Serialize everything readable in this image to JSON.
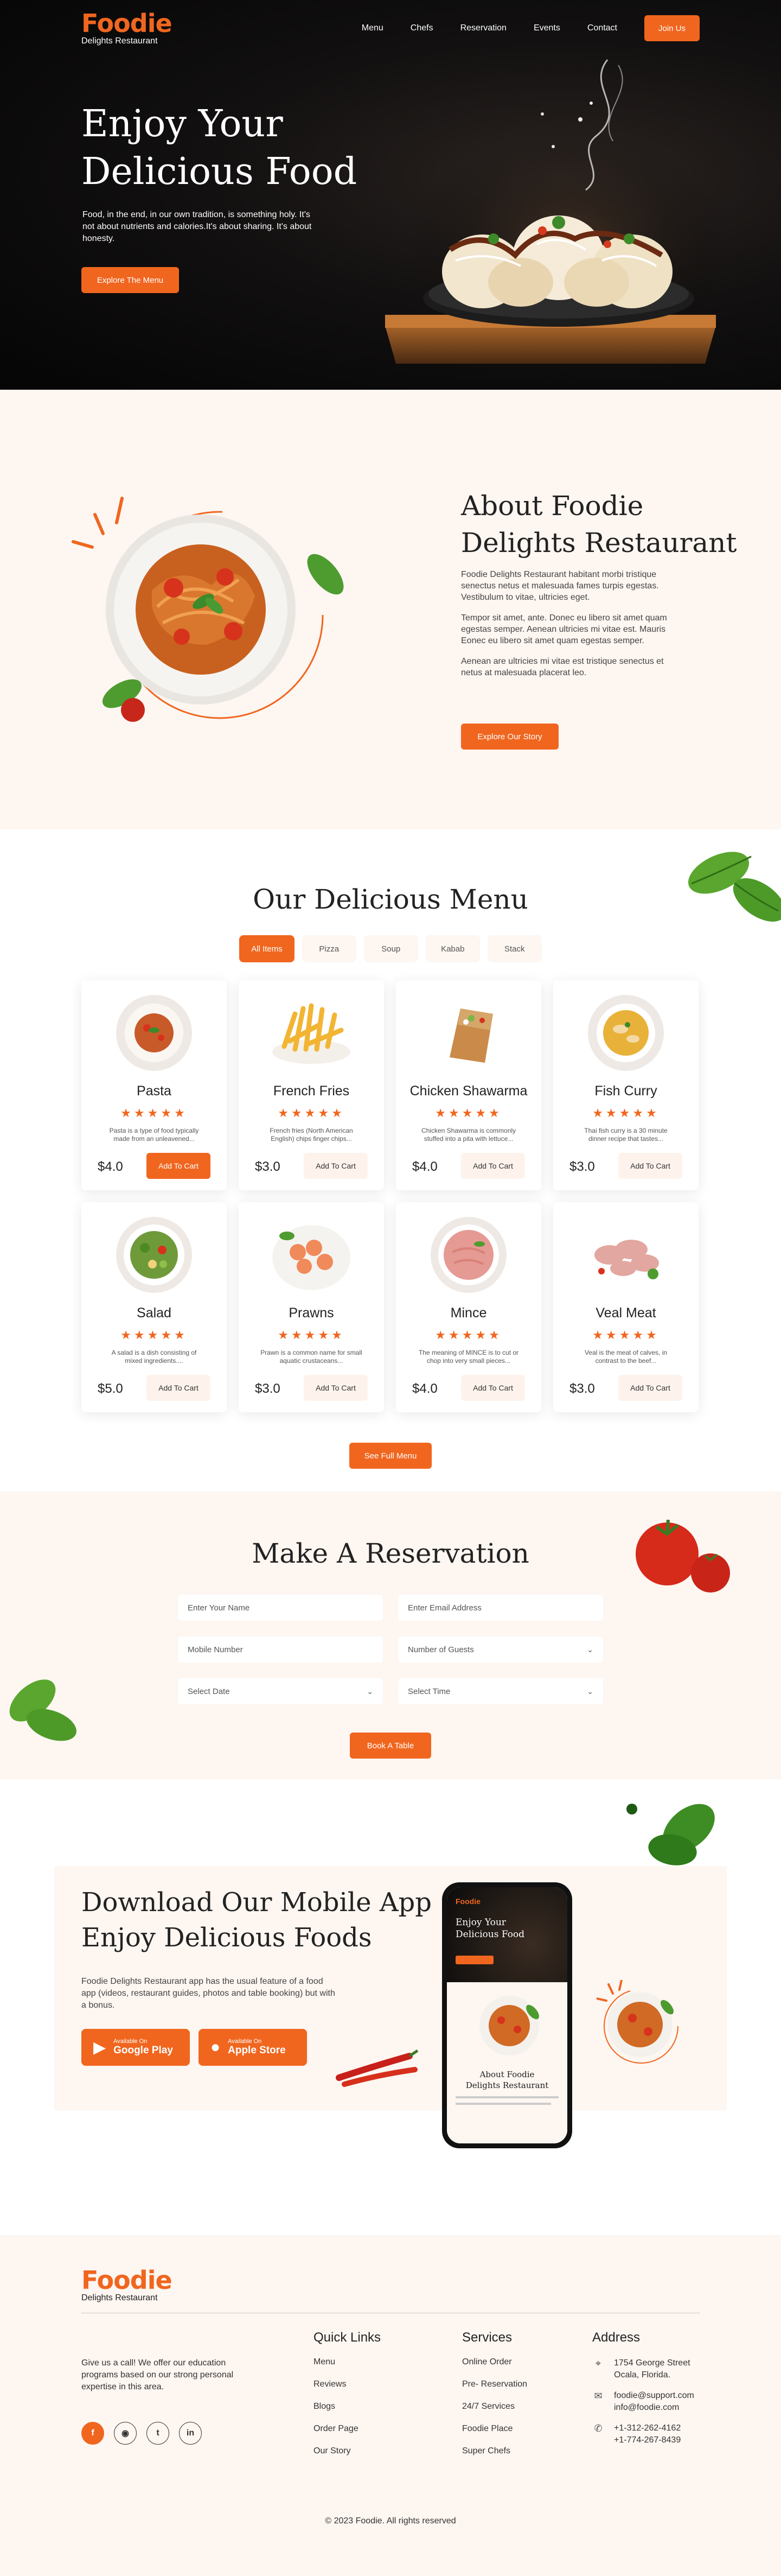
{
  "brand": {
    "name": "Foodie",
    "tagline": "Delights Restaurant"
  },
  "nav": {
    "items": [
      "Menu",
      "Chefs",
      "Reservation",
      "Events",
      "Contact"
    ],
    "join": "Join Us"
  },
  "hero": {
    "title_line1": "Enjoy Your",
    "title_line2": "Delicious Food",
    "text": "Food, in the end, in our own tradition, is something holy. It's not about nutrients and calories.It's about sharing. It's about honesty.",
    "cta": "Explore The Menu"
  },
  "about": {
    "title_line1": "About Foodie",
    "title_line2": "Delights Restaurant",
    "p1": "Foodie Delights Restaurant habitant morbi tristique senectus netus et malesuada fames turpis egestas. Vestibulum to vitae, ultricies eget.",
    "p2": "Tempor sit amet, ante. Donec eu libero sit amet quam egestas semper. Aenean ultricies mi vitae est. Mauris Eonec eu libero sit amet quam egestas semper.",
    "p3": "Aenean are ultricies mi vitae est tristique senectus et netus at malesuada placerat leo.",
    "cta": "Explore Our Story"
  },
  "menu": {
    "title": "Our Delicious Menu",
    "filters": [
      "All Items",
      "Pizza",
      "Soup",
      "Kabab",
      "Stack"
    ],
    "stars": "★★★★★",
    "add": "Add To Cart",
    "full": "See Full Menu",
    "items": [
      {
        "name": "Pasta",
        "desc": "Pasta is a type of food typically made from an unleavened...",
        "price": "$4.0",
        "icon": "pasta-plate",
        "color": "#c85a2a"
      },
      {
        "name": "French Fries",
        "desc": "French fries (North American English) chips finger chips...",
        "price": "$3.0",
        "icon": "fries",
        "color": "#f2b533"
      },
      {
        "name": "Chicken Shawarma",
        "desc": "Chicken Shawarma is commonly stuffed into a pita with lettuce...",
        "price": "$4.0",
        "icon": "wrap",
        "color": "#c98a4a"
      },
      {
        "name": "Fish Curry",
        "desc": "Thai fish curry is a 30 minute dinner recipe that tastes...",
        "price": "$3.0",
        "icon": "curry-bowl",
        "color": "#e8b23a"
      },
      {
        "name": "Salad",
        "desc": "A salad is a dish consisting of mixed ingredients....",
        "price": "$5.0",
        "icon": "salad-bowl",
        "color": "#6f9a3a"
      },
      {
        "name": "Prawns",
        "desc": "Prawn is a common name for small aquatic crustaceans...",
        "price": "$3.0",
        "icon": "prawns-plate",
        "color": "#f08a5a"
      },
      {
        "name": "Mince",
        "desc": "The meaning of MINCE is to cut or chop into very small pieces...",
        "price": "$4.0",
        "icon": "mince-bowl",
        "color": "#e59a93"
      },
      {
        "name": "Veal Meat",
        "desc": "Veal is the meat of calves, in contrast to the beef...",
        "price": "$3.0",
        "icon": "veal-meat",
        "color": "#e2a7a0"
      }
    ]
  },
  "reservation": {
    "title": "Make A Reservation",
    "name_ph": "Enter Your Name",
    "email_ph": "Enter Email Address",
    "mobile_ph": "Mobile Number",
    "guests": "Number of Guests",
    "date": "Select Date",
    "time": "Select Time",
    "book": "Book A Table"
  },
  "app": {
    "title_line1": "Download Our Mobile App",
    "title_line2": "Enjoy Delicious Foods",
    "text": "Foodie Delights Restaurant app has the usual feature of a food app (videos, restaurant guides, photos and table booking) but with a bonus.",
    "google_small": "Available On",
    "google": "Google Play",
    "apple_small": "Available On",
    "apple": "Apple Store",
    "phone": {
      "brand": "Foodie",
      "title_line1": "Enjoy Your",
      "title_line2": "Delicious Food",
      "about_line1": "About Foodie",
      "about_line2": "Delights Restaurant"
    }
  },
  "footer": {
    "blurb": "Give us a call! We offer our education programs based on our strong personal expertise in this area.",
    "socials": [
      "f",
      "◉",
      "t",
      "in"
    ],
    "quick_title": "Quick Links",
    "quick": [
      "Menu",
      "Reviews",
      "Blogs",
      "Order Page",
      "Our Story"
    ],
    "services_title": "Services",
    "services": [
      "Online Order",
      "Pre- Reservation",
      "24/7 Services",
      "Foodie Place",
      "Super Chefs"
    ],
    "address_title": "Address",
    "address_line1": "1754 George Street",
    "address_line2": "Ocala, Florida.",
    "email1": "foodie@support.com",
    "email2": "info@foodie.com",
    "phone1": "+1-312-262-4162",
    "phone2": "+1-774-267-8439",
    "copyright": "© 2023 Foodie. All rights reserved"
  },
  "colors": {
    "accent": "#f0661f",
    "cream": "#fdf6f1",
    "dark": "#0b0b0b"
  }
}
